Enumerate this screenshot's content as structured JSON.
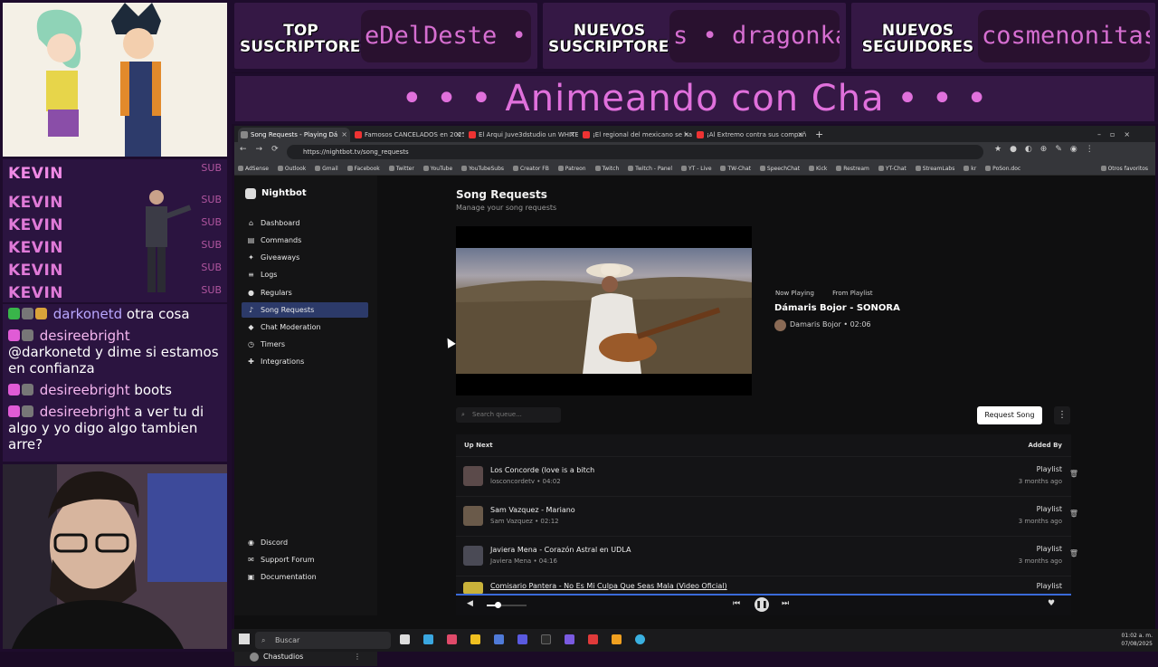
{
  "overlay": {
    "subs": [
      {
        "name": "KEVIN",
        "tag": "SUB"
      },
      {
        "name": "KEVIN",
        "tag": "SUB"
      },
      {
        "name": "KEVIN",
        "tag": "SUB"
      },
      {
        "name": "KEVIN",
        "tag": "SUB"
      },
      {
        "name": "KEVIN",
        "tag": "SUB"
      },
      {
        "name": "KEVIN",
        "tag": "SUB"
      }
    ],
    "chat": [
      {
        "user": "darkonetd",
        "text": "otra cosa"
      },
      {
        "user": "desireebright",
        "text": "@darkonetd y dime si estamos en confianza"
      },
      {
        "user": "desireebright",
        "text": "boots"
      },
      {
        "user": "desireebright",
        "text": "a ver tu di algo y yo digo algo tambien arre?"
      }
    ],
    "banners": [
      {
        "title": "TOP SUSCRIPTORES",
        "ticker": "eDelDeste •"
      },
      {
        "title": "NUEVOS SUSCRIPTORES",
        "ticker": "s • dragonka"
      },
      {
        "title": "NUEVOS SEGUIDORES",
        "ticker": "cosmenonitas"
      }
    ],
    "title": "• • • Animeando con Cha • • •"
  },
  "browser": {
    "tabs": [
      "Song Requests - Playing Dá",
      "Famosos CANCELADOS en 2025",
      "El Arqui Juve3dstudio un WHITEN",
      "¡El regional del mexicano se hace",
      "¡Al Extremo contra sus compañe"
    ],
    "url": "https://nightbot.tv/song_requests",
    "bookmarks": [
      "AdSense",
      "Outlook",
      "Gmail",
      "Facebook",
      "Twitter",
      "YouTube",
      "YouTubeSubs",
      "Creator FB",
      "Patreon",
      "Twitch",
      "Twitch - Panel",
      "YT - Live",
      "TW-Chat",
      "SpeechChat",
      "Kick",
      "Restream",
      "YT-Chat",
      "StreamLabs",
      "kr",
      "PoSon.doc",
      "Otros favoritos"
    ]
  },
  "sidebar": {
    "brand": "Nightbot",
    "items": [
      {
        "label": "Dashboard",
        "icon": "home-icon"
      },
      {
        "label": "Commands",
        "icon": "terminal-icon"
      },
      {
        "label": "Giveaways",
        "icon": "gift-icon"
      },
      {
        "label": "Logs",
        "icon": "list-icon"
      },
      {
        "label": "Regulars",
        "icon": "users-icon"
      },
      {
        "label": "Song Requests",
        "icon": "music-icon"
      },
      {
        "label": "Chat Moderation",
        "icon": "shield-icon"
      },
      {
        "label": "Timers",
        "icon": "clock-icon"
      },
      {
        "label": "Integrations",
        "icon": "puzzle-icon"
      }
    ],
    "footer": [
      {
        "label": "Discord"
      },
      {
        "label": "Support Forum"
      },
      {
        "label": "Documentation"
      }
    ],
    "user": "Chastudios"
  },
  "main": {
    "title": "Song Requests",
    "subtitle": "Manage your song requests",
    "now_playing": {
      "badge1": "Now Playing",
      "badge2": "From Playlist",
      "title": "Dámaris Bojor - SONORA",
      "artist": "Damaris Bojor",
      "duration": "02:06"
    },
    "search_placeholder": "Search queue...",
    "request_button": "Request Song",
    "queue_header": {
      "left": "Up Next",
      "right": "Added By"
    },
    "queue": [
      {
        "title": "Los Concorde (love is a bitch",
        "sub": "losconcordetv • 04:02",
        "source": "Playlist",
        "ago": "3 months ago"
      },
      {
        "title": "Sam Vazquez - Mariano",
        "sub": "Sam Vazquez • 02:12",
        "source": "Playlist",
        "ago": "3 months ago"
      },
      {
        "title": "Javiera Mena - Corazón Astral en UDLA",
        "sub": "Javiera Mena • 04:16",
        "source": "Playlist",
        "ago": "3 months ago"
      },
      {
        "title": "Comisario Pantera - No Es Mi Culpa Que Seas Mala (Video Oficial)",
        "sub": "",
        "source": "Playlist",
        "ago": ""
      }
    ]
  },
  "taskbar": {
    "search": "Buscar",
    "time": "01:02 a. m.",
    "date": "07/08/2025"
  }
}
